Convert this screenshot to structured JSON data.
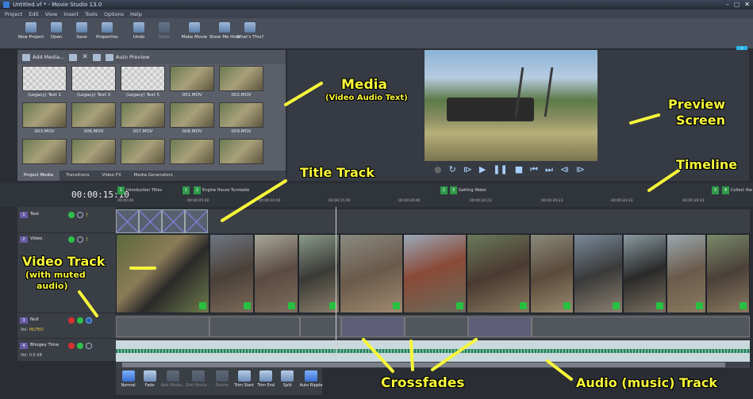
{
  "window": {
    "title": "Untitled.vf * - Movie Studio 13.0",
    "controls": [
      "–",
      "▢",
      "✕"
    ]
  },
  "menu": [
    "Project",
    "Edit",
    "View",
    "Insert",
    "Tools",
    "Options",
    "Help"
  ],
  "toolbar": {
    "buttons": [
      {
        "label": "New Project",
        "enabled": true
      },
      {
        "label": "Open",
        "enabled": true
      },
      {
        "label": "Save",
        "enabled": true
      },
      {
        "label": "Properties",
        "enabled": true
      },
      {
        "label": "Undo",
        "enabled": true
      },
      {
        "label": "Redo",
        "enabled": false
      },
      {
        "label": "Make Movie",
        "enabled": true
      },
      {
        "label": "Show Me How",
        "enabled": true
      },
      {
        "label": "What's This?",
        "enabled": true
      }
    ],
    "help_badge": "?"
  },
  "media_panel": {
    "add_media_label": "Add Media...",
    "auto_preview_label": "Auto Preview",
    "items": [
      {
        "caption": "(Legacy) Text 1",
        "legacy": true
      },
      {
        "caption": "(Legacy) Text 3",
        "legacy": true
      },
      {
        "caption": "(Legacy) Text 5",
        "legacy": true
      },
      {
        "caption": "001.MOV",
        "legacy": false
      },
      {
        "caption": "002.MOV",
        "legacy": false
      },
      {
        "caption": "003.MOV",
        "legacy": false
      },
      {
        "caption": "006.MOV",
        "legacy": false
      },
      {
        "caption": "007.MOV",
        "legacy": false
      },
      {
        "caption": "008.MOV",
        "legacy": false
      },
      {
        "caption": "009.MOV",
        "legacy": false
      },
      {
        "caption": "",
        "legacy": false
      },
      {
        "caption": "",
        "legacy": false
      },
      {
        "caption": "",
        "legacy": false
      },
      {
        "caption": "",
        "legacy": false
      },
      {
        "caption": "",
        "legacy": false
      }
    ],
    "tabs": [
      {
        "label": "Project Media",
        "active": true
      },
      {
        "label": "Transitions",
        "active": false
      },
      {
        "label": "Video FX",
        "active": false
      },
      {
        "label": "Media Generators",
        "active": false
      }
    ]
  },
  "transport": [
    "●",
    "↻",
    "⧐",
    "▶",
    "❚❚",
    "■",
    "⏮",
    "⏭",
    "⧏",
    "⧐"
  ],
  "timeline": {
    "current_time": "00:00:15:10",
    "markers": [
      {
        "num": "1",
        "text": "Introduction Titles"
      },
      {
        "num": "1",
        "text": ""
      },
      {
        "num": "2",
        "text": "Engine House Turntable"
      },
      {
        "num": "2",
        "text": ""
      },
      {
        "num": "3",
        "text": "Getting Water"
      },
      {
        "num": "3",
        "text": ""
      },
      {
        "num": "4",
        "text": "Collect the"
      }
    ],
    "ruler": [
      "00:00:00",
      "00:00:05:00",
      "00:00:10:00",
      "00:00:15:00",
      "00:00:20:00",
      "00:00:24:23",
      "00:00:29:23",
      "00:00:34:23",
      "00:00:39:23"
    ]
  },
  "tracks": [
    {
      "num": "1",
      "name": "Text",
      "vol_label": "",
      "muted_label": ""
    },
    {
      "num": "2",
      "name": "Video",
      "vol_label": "",
      "muted_label": ""
    },
    {
      "num": "3",
      "name": "Null",
      "vol_label": "Vol:",
      "muted_label": "MUTED"
    },
    {
      "num": "4",
      "name": "Bhogey Time",
      "vol_label": "Vol:",
      "muted_label": "0.0 dB"
    }
  ],
  "bottom_toolbar": [
    {
      "label": "Normal",
      "enabled": true,
      "active": true
    },
    {
      "label": "Fade",
      "enabled": true,
      "active": false
    },
    {
      "label": "Add Media...",
      "enabled": false,
      "active": false
    },
    {
      "label": "Edit Media...",
      "enabled": false,
      "active": false
    },
    {
      "label": "Delete",
      "enabled": false,
      "active": false
    },
    {
      "label": "Trim Start",
      "enabled": true,
      "active": false
    },
    {
      "label": "Trim End",
      "enabled": true,
      "active": false
    },
    {
      "label": "Split",
      "enabled": true,
      "active": false
    },
    {
      "label": "Auto Ripple",
      "enabled": true,
      "active": true
    }
  ],
  "annotations": {
    "media": "Media",
    "media_sub": "(Video Audio Text)",
    "preview": "Preview",
    "preview_sub": "Screen",
    "title_track": "Title Track",
    "timeline": "Timeline",
    "video_track": "Video Track",
    "video_sub1": "(with muted",
    "video_sub2": "audio)",
    "crossfades": "Crossfades",
    "audio_track": "Audio (music) Track"
  },
  "colors": {
    "annotation": "#f7f73a",
    "accent": "#27b4e8",
    "marker": "#2f9a4a"
  }
}
